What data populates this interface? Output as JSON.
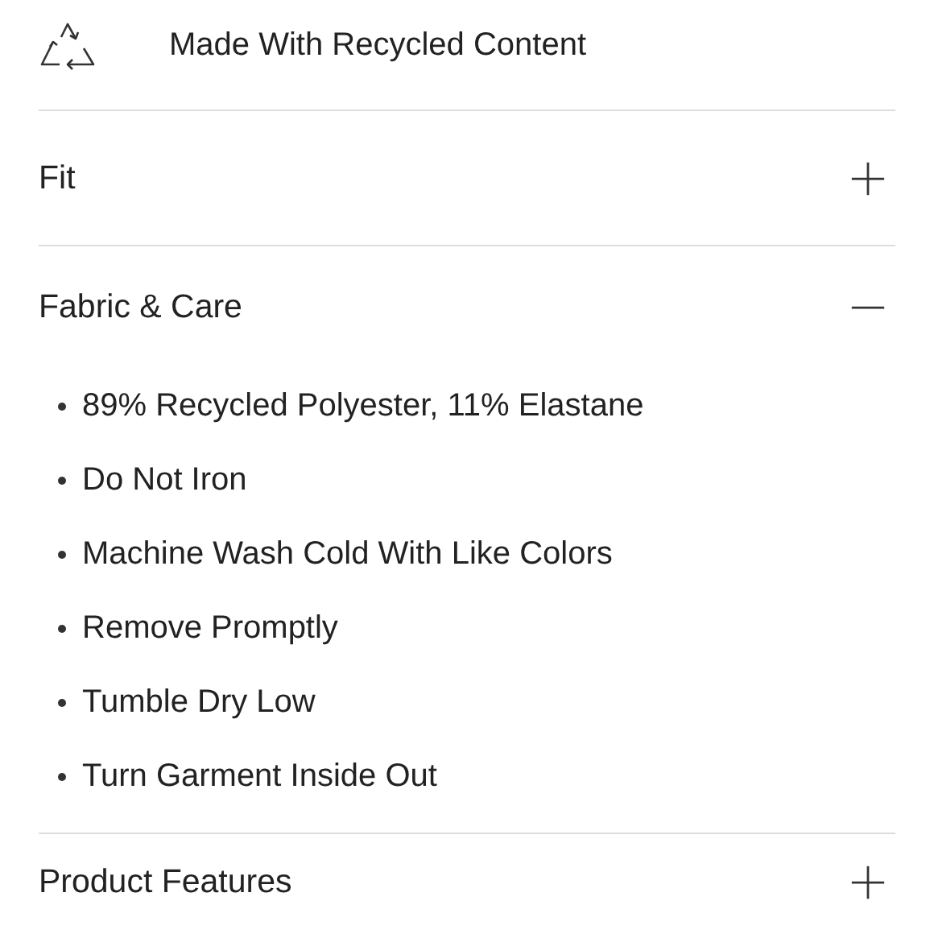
{
  "badge": {
    "label": "Made With Recycled Content"
  },
  "sections": [
    {
      "title": "Fit",
      "expanded": false
    },
    {
      "title": "Fabric & Care",
      "expanded": true,
      "items": [
        "89% Recycled Polyester, 11% Elastane",
        "Do Not Iron",
        "Machine Wash Cold With Like Colors",
        "Remove Promptly",
        "Tumble Dry Low",
        "Turn Garment Inside Out"
      ]
    },
    {
      "title": "Product Features",
      "expanded": false
    }
  ]
}
